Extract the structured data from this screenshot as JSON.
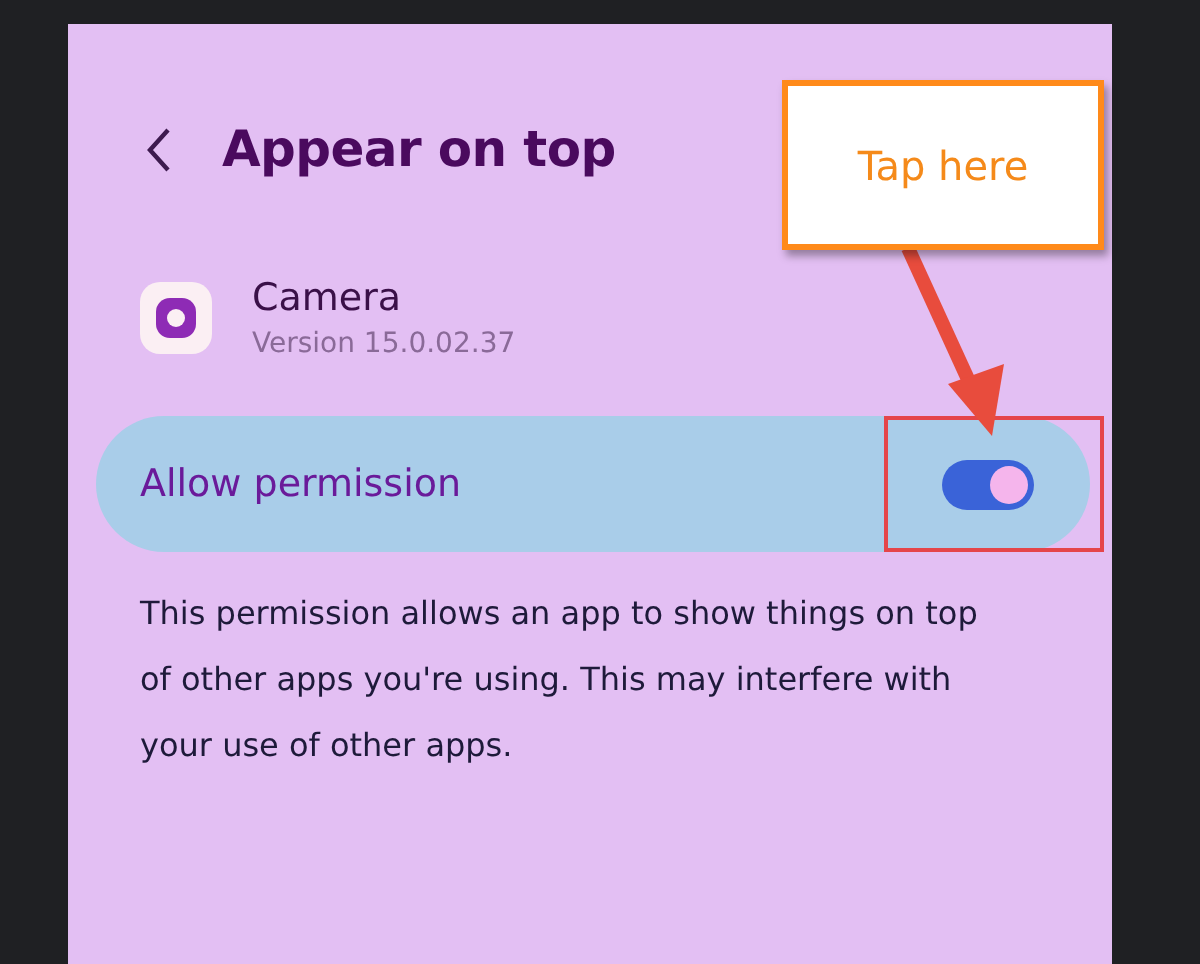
{
  "header": {
    "title": "Appear on top"
  },
  "app": {
    "name": "Camera",
    "version": "Version 15.0.02.37"
  },
  "permission": {
    "label": "Allow permission",
    "on": true
  },
  "description": "This permission allows an app to show things on top of other apps you're using. This may interfere with your use of other apps.",
  "annotation": {
    "callout": "Tap here"
  }
}
